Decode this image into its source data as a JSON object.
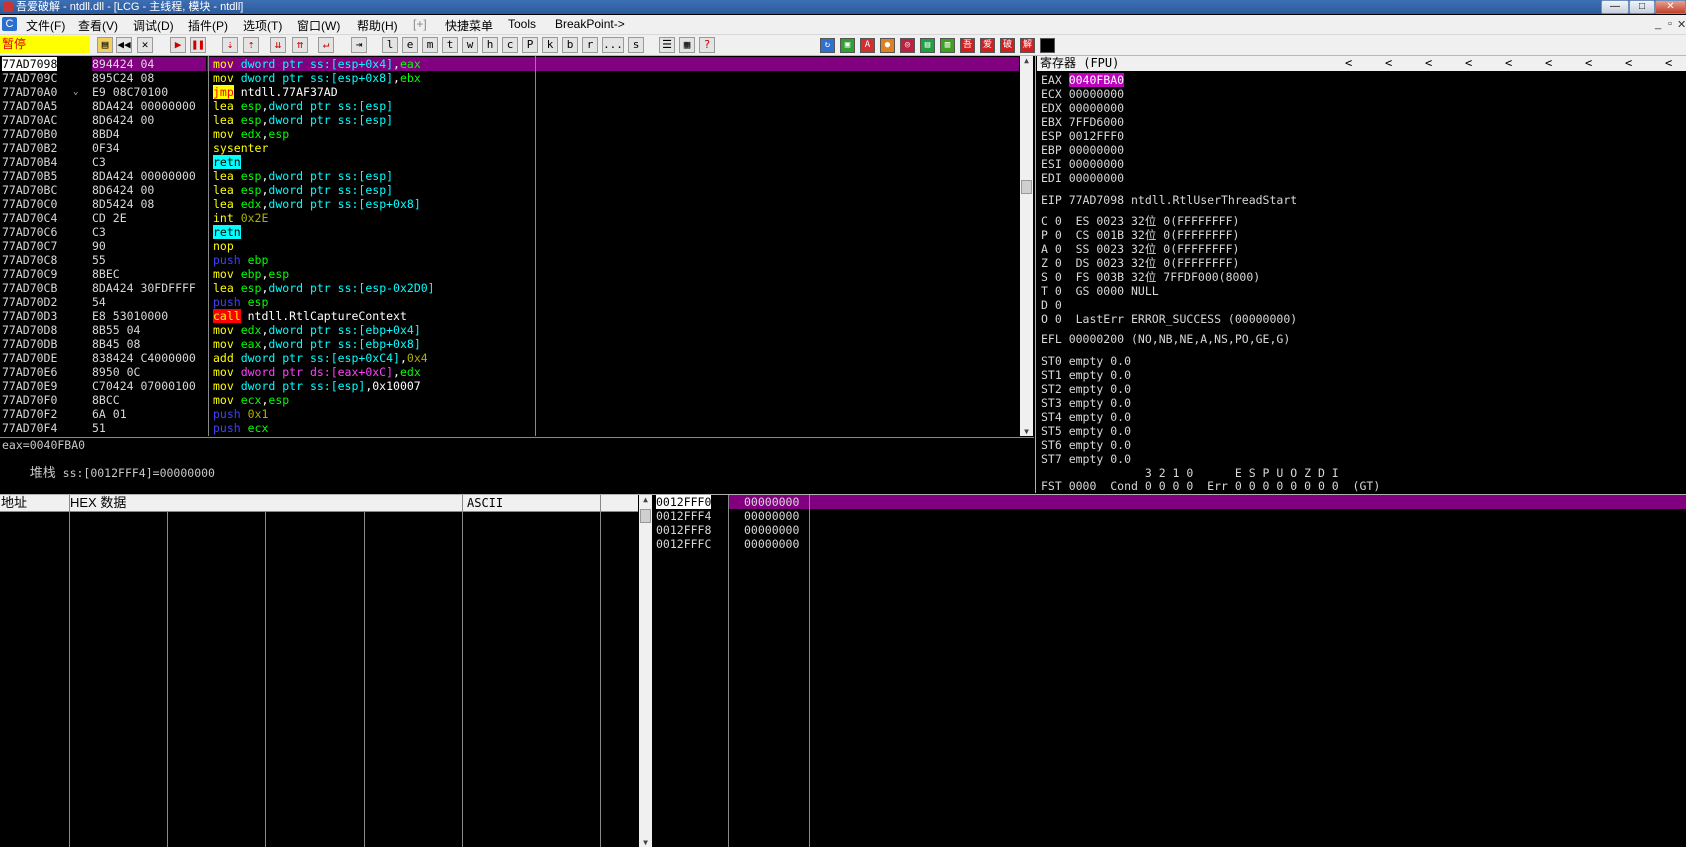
{
  "window": {
    "title": "吾爱破解 - ntdll.dll - [LCG - 主线程, 模块 - ntdll]",
    "buttons": [
      "—",
      "□",
      "✕"
    ]
  },
  "menu": {
    "items": [
      "文件(F)",
      "查看(V)",
      "调试(D)",
      "插件(P)",
      "选项(T)",
      "窗口(W)",
      "帮助(H)",
      "[+]",
      "快捷菜单",
      "Tools",
      "BreakPoint->"
    ],
    "mdi_buttons": [
      "_",
      "▫",
      "✕"
    ]
  },
  "toolbar": {
    "status": "暂停",
    "buttons": [
      "▶",
      "◀◀",
      "✕",
      "▶",
      "❚❚",
      "⇣",
      "⇡",
      "⇊",
      "⇈",
      "↵",
      "⇥",
      "l",
      "e",
      "m",
      "t",
      "w",
      "h",
      "c",
      "P",
      "k",
      "b",
      "r",
      "...",
      "s",
      "☰",
      "▦",
      "?"
    ],
    "color_buttons": [
      "↻",
      "▣",
      "A",
      "●",
      "◎",
      "▤",
      "▥",
      "吾",
      "爱",
      "破",
      "解",
      "■"
    ]
  },
  "disasm": {
    "rows": [
      {
        "addr": "77AD7098",
        "hex": "894424 04",
        "ins": [
          [
            "mov ",
            "c-mnem"
          ],
          [
            "dword ptr ",
            "c-dword"
          ],
          [
            "ss:[esp+0x4]",
            "c-dword"
          ],
          [
            ",",
            "c-white"
          ],
          [
            "eax",
            "c-reg"
          ]
        ],
        "selected": true
      },
      {
        "addr": "77AD709C",
        "hex": "895C24 08",
        "ins": [
          [
            "mov ",
            "c-mnem"
          ],
          [
            "dword ptr ss:[esp+0x8]",
            "c-dword"
          ],
          [
            ",",
            "c-white"
          ],
          [
            "ebx",
            "c-reg"
          ]
        ]
      },
      {
        "addr": "77AD70A0",
        "hex": "E9 08C70100",
        "mark": "⌄",
        "ins": [
          [
            "jmp",
            "hl-jmp"
          ],
          [
            " ntdll.77AF37AD",
            "c-white"
          ]
        ]
      },
      {
        "addr": "77AD70A5",
        "hex": "8DA424 00000000",
        "ins": [
          [
            "lea ",
            "c-mnem"
          ],
          [
            "esp",
            "c-reg"
          ],
          [
            ",",
            "c-white"
          ],
          [
            "dword ptr ss:[esp]",
            "c-dword"
          ]
        ]
      },
      {
        "addr": "77AD70AC",
        "hex": "8D6424 00",
        "ins": [
          [
            "lea ",
            "c-mnem"
          ],
          [
            "esp",
            "c-reg"
          ],
          [
            ",",
            "c-white"
          ],
          [
            "dword ptr ss:[esp]",
            "c-dword"
          ]
        ]
      },
      {
        "addr": "77AD70B0",
        "hex": "8BD4",
        "ins": [
          [
            "mov ",
            "c-mnem"
          ],
          [
            "edx",
            "c-reg"
          ],
          [
            ",",
            "c-white"
          ],
          [
            "esp",
            "c-reg"
          ]
        ]
      },
      {
        "addr": "77AD70B2",
        "hex": "0F34",
        "ins": [
          [
            "sysenter",
            "c-mnem"
          ]
        ]
      },
      {
        "addr": "77AD70B4",
        "hex": "C3",
        "ins": [
          [
            "retn",
            "hl-retn"
          ]
        ]
      },
      {
        "addr": "77AD70B5",
        "hex": "8DA424 00000000",
        "ins": [
          [
            "lea ",
            "c-mnem"
          ],
          [
            "esp",
            "c-reg"
          ],
          [
            ",",
            "c-white"
          ],
          [
            "dword ptr ss:[esp]",
            "c-dword"
          ]
        ]
      },
      {
        "addr": "77AD70BC",
        "hex": "8D6424 00",
        "ins": [
          [
            "lea ",
            "c-mnem"
          ],
          [
            "esp",
            "c-reg"
          ],
          [
            ",",
            "c-white"
          ],
          [
            "dword ptr ss:[esp]",
            "c-dword"
          ]
        ]
      },
      {
        "addr": "77AD70C0",
        "hex": "8D5424 08",
        "ins": [
          [
            "lea ",
            "c-mnem"
          ],
          [
            "edx",
            "c-reg"
          ],
          [
            ",",
            "c-white"
          ],
          [
            "dword ptr ss:[esp+0x8]",
            "c-dword"
          ]
        ]
      },
      {
        "addr": "77AD70C4",
        "hex": "CD 2E",
        "ins": [
          [
            "int ",
            "c-mnem"
          ],
          [
            "0x2E",
            "c-imm"
          ]
        ]
      },
      {
        "addr": "77AD70C6",
        "hex": "C3",
        "ins": [
          [
            "retn",
            "hl-retn"
          ]
        ]
      },
      {
        "addr": "77AD70C7",
        "hex": "90",
        "ins": [
          [
            "nop",
            "c-mnem"
          ]
        ]
      },
      {
        "addr": "77AD70C8",
        "hex": "55",
        "ins": [
          [
            "push ",
            "c-push"
          ],
          [
            "ebp",
            "c-reg"
          ]
        ]
      },
      {
        "addr": "77AD70C9",
        "hex": "8BEC",
        "ins": [
          [
            "mov ",
            "c-mnem"
          ],
          [
            "ebp",
            "c-reg"
          ],
          [
            ",",
            "c-white"
          ],
          [
            "esp",
            "c-reg"
          ]
        ]
      },
      {
        "addr": "77AD70CB",
        "hex": "8DA424 30FDFFFF",
        "ins": [
          [
            "lea ",
            "c-mnem"
          ],
          [
            "esp",
            "c-reg"
          ],
          [
            ",",
            "c-white"
          ],
          [
            "dword ptr ss:[esp-0x2D0]",
            "c-dword"
          ]
        ]
      },
      {
        "addr": "77AD70D2",
        "hex": "54",
        "ins": [
          [
            "push ",
            "c-push"
          ],
          [
            "esp",
            "c-reg"
          ]
        ]
      },
      {
        "addr": "77AD70D3",
        "hex": "E8 53010000",
        "ins": [
          [
            "call",
            "hl-call"
          ],
          [
            " ntdll.RtlCaptureContext",
            "c-white"
          ]
        ]
      },
      {
        "addr": "77AD70D8",
        "hex": "8B55 04",
        "ins": [
          [
            "mov ",
            "c-mnem"
          ],
          [
            "edx",
            "c-reg"
          ],
          [
            ",",
            "c-white"
          ],
          [
            "dword ptr ss:[ebp+0x4]",
            "c-dword"
          ]
        ]
      },
      {
        "addr": "77AD70DB",
        "hex": "8B45 08",
        "ins": [
          [
            "mov ",
            "c-mnem"
          ],
          [
            "eax",
            "c-reg"
          ],
          [
            ",",
            "c-white"
          ],
          [
            "dword ptr ss:[ebp+0x8]",
            "c-dword"
          ]
        ]
      },
      {
        "addr": "77AD70DE",
        "hex": "838424 C4000000",
        "ins": [
          [
            "add ",
            "c-mnem"
          ],
          [
            "dword ptr ss:[esp+0xC4]",
            "c-dword"
          ],
          [
            ",",
            "c-white"
          ],
          [
            "0x4",
            "c-imm"
          ]
        ]
      },
      {
        "addr": "77AD70E6",
        "hex": "8950 0C",
        "ins": [
          [
            "mov ",
            "c-mnem"
          ],
          [
            "dword ptr ds:[eax+0xC]",
            "c-mag"
          ],
          [
            ",",
            "c-white"
          ],
          [
            "edx",
            "c-reg"
          ]
        ]
      },
      {
        "addr": "77AD70E9",
        "hex": "C70424 07000100",
        "ins": [
          [
            "mov ",
            "c-mnem"
          ],
          [
            "dword ptr ss:[esp]",
            "c-dword"
          ],
          [
            ",0x10007",
            "c-white"
          ]
        ]
      },
      {
        "addr": "77AD70F0",
        "hex": "8BCC",
        "ins": [
          [
            "mov ",
            "c-mnem"
          ],
          [
            "ecx",
            "c-reg"
          ],
          [
            ",",
            "c-white"
          ],
          [
            "esp",
            "c-reg"
          ]
        ]
      },
      {
        "addr": "77AD70F2",
        "hex": "6A 01",
        "ins": [
          [
            "push ",
            "c-push"
          ],
          [
            "0x1",
            "c-imm"
          ]
        ]
      },
      {
        "addr": "77AD70F4",
        "hex": "51",
        "ins": [
          [
            "push ",
            "c-push"
          ],
          [
            "ecx",
            "c-reg"
          ]
        ]
      }
    ]
  },
  "info": {
    "line1": "eax=0040FBA0",
    "line2_label": "堆栈",
    "line2_value": " ss:[0012FFF4]=00000000"
  },
  "registers": {
    "header": "寄存器 (FPU)",
    "nav_arrows": [
      "<",
      "<",
      "<",
      "<",
      "<",
      "<",
      "<",
      "<",
      "<"
    ],
    "gp": [
      {
        "name": "EAX",
        "value": "0040FBA0",
        "highlight": true
      },
      {
        "name": "ECX",
        "value": "00000000"
      },
      {
        "name": "EDX",
        "value": "00000000"
      },
      {
        "name": "EBX",
        "value": "7FFD6000"
      },
      {
        "name": "ESP",
        "value": "0012FFF0"
      },
      {
        "name": "EBP",
        "value": "00000000"
      },
      {
        "name": "ESI",
        "value": "00000000"
      },
      {
        "name": "EDI",
        "value": "00000000"
      }
    ],
    "eip": "EIP 77AD7098 ntdll.RtlUserThreadStart",
    "flags": [
      "C 0  ES 0023 32位 0(FFFFFFFF)",
      "P 0  CS 001B 32位 0(FFFFFFFF)",
      "A 0  SS 0023 32位 0(FFFFFFFF)",
      "Z 0  DS 0023 32位 0(FFFFFFFF)",
      "S 0  FS 003B 32位 7FFDF000(8000)",
      "T 0  GS 0000 NULL",
      "D 0",
      "O 0  LastErr ERROR_SUCCESS (00000000)"
    ],
    "efl": "EFL 00000200 (NO,NB,NE,A,NS,PO,GE,G)",
    "fpu": [
      "ST0 empty 0.0",
      "ST1 empty 0.0",
      "ST2 empty 0.0",
      "ST3 empty 0.0",
      "ST4 empty 0.0",
      "ST5 empty 0.0",
      "ST6 empty 0.0",
      "ST7 empty 0.0"
    ],
    "fpu_bits": "               3 2 1 0      E S P U O Z D I",
    "fst": "FST 0000  Cond 0 0 0 0  Err 0 0 0 0 0 0 0 0  (GT)"
  },
  "dump": {
    "headers": [
      "地址",
      "HEX 数据",
      "ASCII"
    ]
  },
  "stack": {
    "rows": [
      {
        "addr": "0012FFF0",
        "value": "00000000",
        "selected": true
      },
      {
        "addr": "0012FFF4",
        "value": "00000000"
      },
      {
        "addr": "0012FFF8",
        "value": "00000000"
      },
      {
        "addr": "0012FFFC",
        "value": "00000000"
      }
    ]
  },
  "colors": {
    "selection": "#800080",
    "status_bg": "#ffff00",
    "status_fg": "#e00000"
  }
}
